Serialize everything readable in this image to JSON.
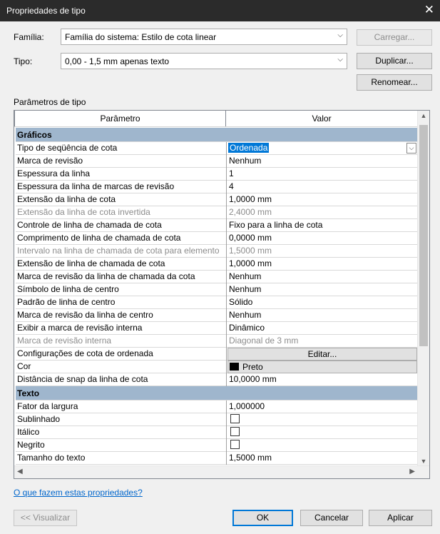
{
  "window": {
    "title": "Propriedades de tipo",
    "close_glyph": "✕"
  },
  "family": {
    "label": "Família:",
    "value": "Família do sistema: Estilo de cota linear",
    "load_button": "Carregar..."
  },
  "type": {
    "label": "Tipo:",
    "value": "0,00 - 1,5 mm apenas texto",
    "duplicate_button": "Duplicar...",
    "rename_button": "Renomear..."
  },
  "params": {
    "section_label": "Parâmetros de tipo",
    "col_param": "Parâmetro",
    "col_value": "Valor",
    "group_graphics": "Gráficos",
    "group_text": "Texto",
    "rows": [
      {
        "k": "Tipo de seqüência de cota",
        "v": "Ordenada"
      },
      {
        "k": "Marca de revisão",
        "v": "Nenhum"
      },
      {
        "k": "Espessura da linha",
        "v": "1"
      },
      {
        "k": "Espessura da linha de marcas de revisão",
        "v": "4"
      },
      {
        "k": "Extensão da linha de cota",
        "v": "1,0000 mm"
      },
      {
        "k": "Extensão da linha de cota invertida",
        "v": "2,4000 mm"
      },
      {
        "k": "Controle de linha de chamada de cota",
        "v": "Fixo para a linha de cota"
      },
      {
        "k": "Comprimento de linha de chamada de cota",
        "v": "0,0000 mm"
      },
      {
        "k": "Intervalo na linha de chamada de cota para elemento",
        "v": "1,5000 mm"
      },
      {
        "k": "Extensão de linha de chamada de cota",
        "v": "1,0000 mm"
      },
      {
        "k": "Marca de revisão da linha de chamada da cota",
        "v": "Nenhum"
      },
      {
        "k": "Símbolo de linha de centro",
        "v": "Nenhum"
      },
      {
        "k": "Padrão de linha de centro",
        "v": "Sólido"
      },
      {
        "k": "Marca de revisão da linha de centro",
        "v": "Nenhum"
      },
      {
        "k": "Exibir a marca de revisão interna",
        "v": "Dinâmico"
      },
      {
        "k": "Marca de revisão interna",
        "v": "Diagonal de 3 mm"
      },
      {
        "k": "Configurações de cota de ordenada",
        "v": "Editar..."
      },
      {
        "k": "Cor",
        "v": "Preto"
      },
      {
        "k": "Distância de snap da linha de cota",
        "v": "10,0000 mm"
      },
      {
        "k": "Fator da largura",
        "v": "1,000000"
      },
      {
        "k": "Sublinhado",
        "v": ""
      },
      {
        "k": "Itálico",
        "v": ""
      },
      {
        "k": "Negrito",
        "v": ""
      },
      {
        "k": "Tamanho do texto",
        "v": "1,5000 mm"
      }
    ]
  },
  "footer": {
    "help_link": "O que fazem estas propriedades?",
    "preview_button": "<< Visualizar",
    "ok_button": "OK",
    "cancel_button": "Cancelar",
    "apply_button": "Aplicar"
  },
  "colors": {
    "group_header": "#9fb6cd",
    "selection": "#0078d7",
    "titlebar": "#2b2b2b"
  }
}
